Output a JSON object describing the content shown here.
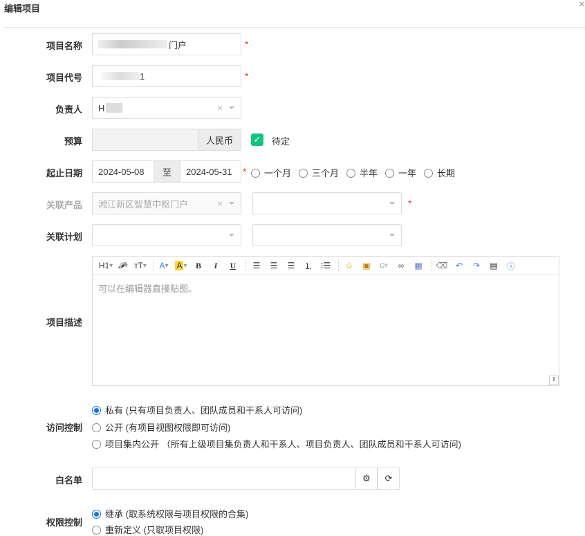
{
  "dialog": {
    "title": "编辑项目",
    "close": "×"
  },
  "labels": {
    "name": "项目名称",
    "code": "项目代号",
    "owner": "负责人",
    "budget": "预算",
    "dates": "起止日期",
    "product": "关联产品",
    "plan": "关联计划",
    "desc": "项目描述",
    "access": "访问控制",
    "whitelist": "白名单",
    "perm": "权限控制"
  },
  "fields": {
    "name": "门户",
    "code": "1",
    "owner": "H",
    "currency": "人民币",
    "pending": "待定",
    "start": "2024-05-08",
    "to": "至",
    "end": "2024-05-31",
    "product": "湘江新区智慧中枢门户",
    "required": "*"
  },
  "durations": [
    "一个月",
    "三个月",
    "半年",
    "一年",
    "长期"
  ],
  "editor": {
    "placeholder": "可以在编辑器直接贴图。",
    "h1": "H1",
    "font": "𝓕",
    "size": "тT",
    "color": "A",
    "bg": "A",
    "bold": "B",
    "italic": "I",
    "underline": "U"
  },
  "access": [
    "私有 (只有项目负责人、团队成员和干系人可访问)",
    "公开 (有项目视图权限即可访问)",
    "项目集内公开 （所有上级项目集负责人和干系人、项目负责人、团队成员和干系人可访问)"
  ],
  "perm": [
    "继承 (取系统权限与项目权限的合集)",
    "重新定义 (只取项目权限)"
  ],
  "colors": {
    "accent": "#1e6fe0",
    "check": "#13c47f",
    "required": "#e53935"
  }
}
